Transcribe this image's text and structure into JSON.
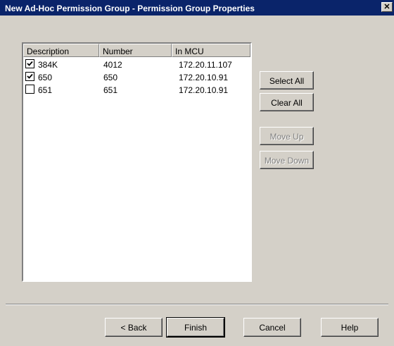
{
  "window": {
    "title": "New Ad-Hoc Permission Group - Permission Group Properties",
    "close_glyph": "✕"
  },
  "list": {
    "columns": [
      "Description",
      "Number",
      "In MCU"
    ],
    "rows": [
      {
        "checked": true,
        "description": "384K",
        "number": "4012",
        "in_mcu": "172.20.11.107"
      },
      {
        "checked": true,
        "description": "650",
        "number": "650",
        "in_mcu": "172.20.10.91"
      },
      {
        "checked": false,
        "description": "651",
        "number": "651",
        "in_mcu": "172.20.10.91"
      }
    ]
  },
  "side_buttons": {
    "select_all": "Select All",
    "clear_all": "Clear All",
    "move_up": "Move Up",
    "move_down": "Move Down"
  },
  "footer_buttons": {
    "back": "< Back",
    "finish": "Finish",
    "cancel": "Cancel",
    "help": "Help"
  }
}
